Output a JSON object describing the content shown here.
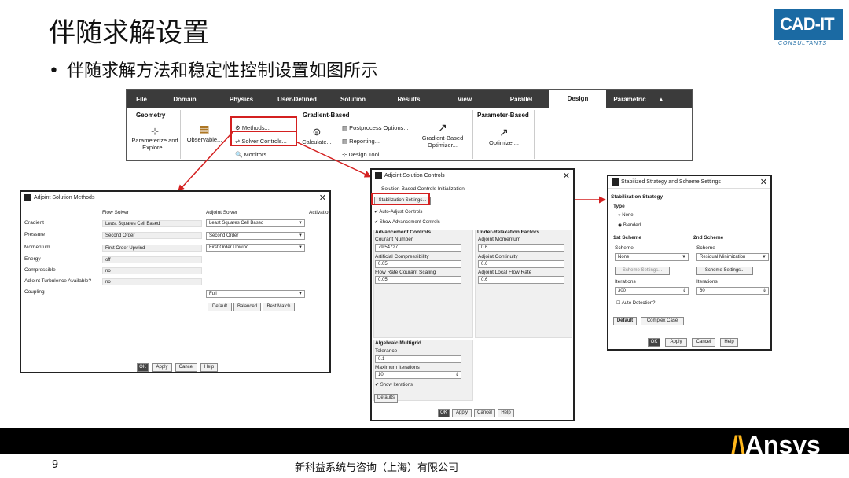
{
  "slide": {
    "title": "伴随求解设置",
    "bullet": "伴随求解方法和稳定性控制设置如图所示",
    "page_number": "9",
    "company": "新科益系统与咨询（上海）有限公司",
    "ansys_logo": "Ansys",
    "logo": {
      "main": "CAD-IT",
      "sub": "CONSULTANTS"
    }
  },
  "ribbon": {
    "tabs": [
      "File",
      "Domain",
      "Physics",
      "User-Defined",
      "Solution",
      "Results",
      "View",
      "Parallel",
      "Design",
      "Parametric"
    ],
    "active_tab": "Design",
    "groups": {
      "geometry": {
        "title": "Geometry",
        "item": "Parameterize and Explore...",
        "observable": "Observable..."
      },
      "gradient": {
        "title": "Gradient-Based",
        "methods": "Methods...",
        "solver_controls": "Solver Controls...",
        "monitors": "Monitors...",
        "calculate": "Calculate...",
        "postprocess": "Postprocess Options...",
        "reporting": "Reporting...",
        "design_tool": "Design Tool...",
        "optimizer": "Gradient-Based Optimizer..."
      },
      "parameter": {
        "title": "Parameter-Based",
        "optimizer": "Optimizer..."
      }
    }
  },
  "methods_dialog": {
    "title": "Adjoint Solution Methods",
    "col_flow": "Flow Solver",
    "col_adjoint": "Adjoint Solver",
    "col_activation": "Activation",
    "rows": [
      {
        "label": "Gradient",
        "flow": "Least Squares Cell Based",
        "adjoint": "Least Squares Cell Based"
      },
      {
        "label": "Pressure",
        "flow": "Second Order",
        "adjoint": "Second Order"
      },
      {
        "label": "Momentum",
        "flow": "First Order Upwind",
        "adjoint": "First Order Upwind"
      },
      {
        "label": "Energy",
        "flow": "off"
      },
      {
        "label": "Compressible",
        "flow": "no"
      },
      {
        "label": "Adjoint Turbulence Available?",
        "flow": "no"
      },
      {
        "label": "Coupling",
        "adjoint": "Full"
      }
    ],
    "btn_default": "Default",
    "btn_balanced": "Balanced",
    "btn_best": "Best Match",
    "ok": "OK",
    "apply": "Apply",
    "cancel": "Cancel",
    "help": "Help"
  },
  "controls_dialog": {
    "title": "Adjoint Solution Controls",
    "init_label": "Solution-Based Controls Initialization",
    "stab_button": "Stabilization Settings...",
    "auto_adjust": "Auto-Adjust Controls",
    "show_adv": "Show Advancement Controls",
    "adv_title": "Advancement Controls",
    "courant_label": "Courant Number",
    "courant_value": "79.54727",
    "compress_label": "Artificial Compressibility",
    "compress_value": "0.05",
    "flowrate_label": "Flow Rate Courant Scaling",
    "flowrate_value": "0.05",
    "ur_title": "Under-Relaxation Factors",
    "mom_label": "Adjoint Momentum",
    "mom_value": "0.6",
    "cont_label": "Adjoint Continuity",
    "cont_value": "0.6",
    "lfr_label": "Adjoint Local Flow Rate",
    "lfr_value": "0.6",
    "amg_title": "Algebraic Multigrid",
    "tol_label": "Tolerance",
    "tol_value": "0.1",
    "maxit_label": "Maximum Iterations",
    "maxit_value": "10",
    "show_it": "Show Iterations",
    "defaults": "Defaults",
    "ok": "OK",
    "apply": "Apply",
    "cancel": "Cancel",
    "help": "Help"
  },
  "scheme_dialog": {
    "title": "Stabilized Strategy and Scheme Settings",
    "strategy_title": "Stabilization Strategy",
    "type_label": "Type",
    "none": "None",
    "blended": "Blended",
    "first_scheme": "1st Scheme",
    "second_scheme": "2nd Scheme",
    "scheme_label": "Scheme",
    "scheme1_value": "None",
    "scheme2_value": "Residual Minimization",
    "scheme_settings": "Scheme Settings...",
    "iterations_label": "Iterations",
    "it1": "300",
    "it2": "60",
    "auto_detect": "Auto Detection?",
    "default": "Default",
    "complex_case": "Complex Case",
    "ok": "OK",
    "apply": "Apply",
    "cancel": "Cancel",
    "help": "Help"
  },
  "colors": {
    "highlight": "#d42020",
    "ribbon_bg": "#3b3b3b",
    "logo_blue": "#1b6aa3",
    "ansys_yellow": "#ffb71b"
  }
}
